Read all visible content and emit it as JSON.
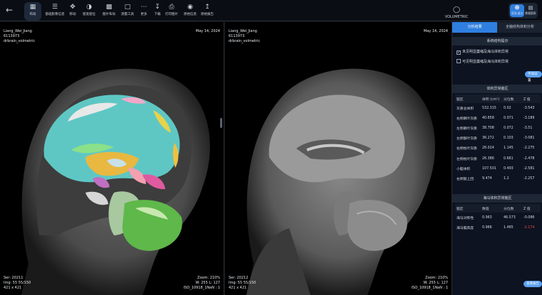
{
  "toolbar": {
    "tools": [
      {
        "id": "layout",
        "icon": "grid-icon",
        "label": "布局"
      },
      {
        "id": "series",
        "icon": "list-icon",
        "label": "基础影像信息"
      },
      {
        "id": "move",
        "icon": "move-icon",
        "label": "移动"
      },
      {
        "id": "window",
        "icon": "contrast-icon",
        "label": "窗宽窗位"
      },
      {
        "id": "tiles",
        "icon": "tiles-icon",
        "label": "图片布局"
      },
      {
        "id": "measure",
        "icon": "ruler-icon",
        "label": "测量工具"
      },
      {
        "id": "more",
        "icon": "more-icon",
        "label": "更多"
      },
      {
        "id": "download",
        "icon": "download-icon",
        "label": "下载"
      },
      {
        "id": "print",
        "icon": "printer-icon",
        "label": "打印图片"
      },
      {
        "id": "orig",
        "icon": "eye-icon",
        "label": "原始信息"
      },
      {
        "id": "report",
        "icon": "upload-icon",
        "label": "原始报告"
      }
    ],
    "title": "VOLUMETRIC",
    "seg": [
      {
        "icon": "person-icon",
        "label": "登录/退出"
      },
      {
        "icon": "data-icon",
        "label": "数据图表"
      }
    ]
  },
  "left": {
    "name": "Liang_Wei_Jiang",
    "id": "6113973",
    "study": "drbrain_volmetric",
    "date": "May 14, 2024",
    "ser": "Ser: 20211",
    "img": "Img: 55 55/150",
    "size": "421 x 421",
    "zoom": "Zoom: 210%",
    "wl": "W: 255 L: 127",
    "iso": "ISO_10918_1NaN : 1"
  },
  "right": {
    "name": "Liang_Wei_Jiang",
    "id": "6113973",
    "study": "drbrain_volmetric",
    "date": "May 14, 2024",
    "ser": "Ser: 20212",
    "img": "Img: 55 55/150",
    "size": "421 x 421",
    "zoom": "Zoom: 210%",
    "wl": "W: 255 L: 127",
    "iso": "ISO_10918_1NaN : 1"
  },
  "panel": {
    "tabs": [
      "分析结果",
      "全脑结构体积分析"
    ],
    "sys_title": "系统结构提示",
    "check1": "未见明显萎缩及海马体积异常",
    "check2": "可见明显萎缩及海马体积异常",
    "manual_btn": "手动设置",
    "vol_title": "体积异常脑区",
    "vol_headers": [
      "脑区",
      "体积 (cm³)",
      "分位数",
      "Z 值"
    ],
    "vol_rows": [
      [
        "灰质总体积",
        "532.315",
        "0.02",
        "-3.543"
      ],
      [
        "右侧颞叶灰质",
        "40.658",
        "0.071",
        "-3.189"
      ],
      [
        "左侧颞叶灰质",
        "38.708",
        "0.072",
        "-3.51"
      ],
      [
        "左侧额叶灰质",
        "36.272",
        "0.103",
        "-3.081"
      ],
      [
        "右侧枕叶灰质",
        "26.024",
        "1.145",
        "-2.275"
      ],
      [
        "左侧枕叶灰质",
        "26.386",
        "0.661",
        "-2.478"
      ],
      [
        "小脑体积",
        "107.501",
        "0.493",
        "-2.581"
      ],
      [
        "右侧额上回",
        "9.474",
        "1.2",
        "-2.257"
      ]
    ],
    "hip_title": "海马体积异常脑区",
    "hip_headers": [
      "脑区",
      "数值",
      "分位数",
      "Z 值"
    ],
    "hip_rows": [
      [
        "海马对称性",
        "0.963",
        "46.573",
        "-0.086"
      ],
      [
        "海马脑高度",
        "0.966",
        "1.465",
        "-2.174"
      ]
    ],
    "report_btn": "查看报告"
  }
}
